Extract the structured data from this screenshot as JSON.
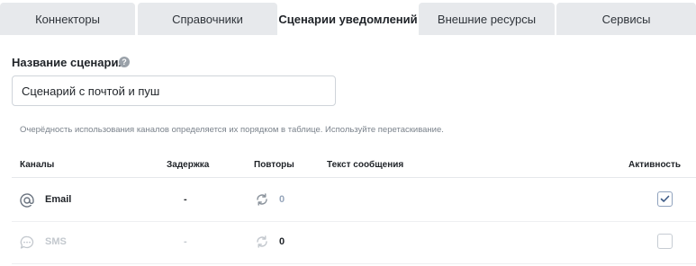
{
  "tabs": [
    {
      "label": "Коннекторы",
      "active": false
    },
    {
      "label": "Справочники",
      "active": false
    },
    {
      "label": "Сценарии уведомлений",
      "active": true
    },
    {
      "label": "Внешние ресурсы",
      "active": false
    },
    {
      "label": "Сервисы",
      "active": false
    }
  ],
  "form": {
    "name_label": "Название сценария",
    "help_glyph": "?",
    "name_value": "Сценарий с почтой и пуш"
  },
  "hint": "Очерёдность использования каналов определяется их порядком в таблице. Используйте перетаскивание.",
  "table": {
    "headers": {
      "channels": "Каналы",
      "delay": "Задержка",
      "repeats": "Повторы",
      "message": "Текст сообщения",
      "active": "Активность"
    },
    "rows": [
      {
        "channel": "Email",
        "icon": "at-sign-icon",
        "delay": "-",
        "repeats": "0",
        "active": true,
        "enabled": true
      },
      {
        "channel": "SMS",
        "icon": "chat-bubble-icon",
        "delay": "-",
        "repeats": "0",
        "active": false,
        "enabled": false
      }
    ]
  },
  "colors": {
    "tab_inactive": "#e7e9ec",
    "muted_text": "#c3c8ce",
    "repeat_value": "#97a6bb"
  }
}
